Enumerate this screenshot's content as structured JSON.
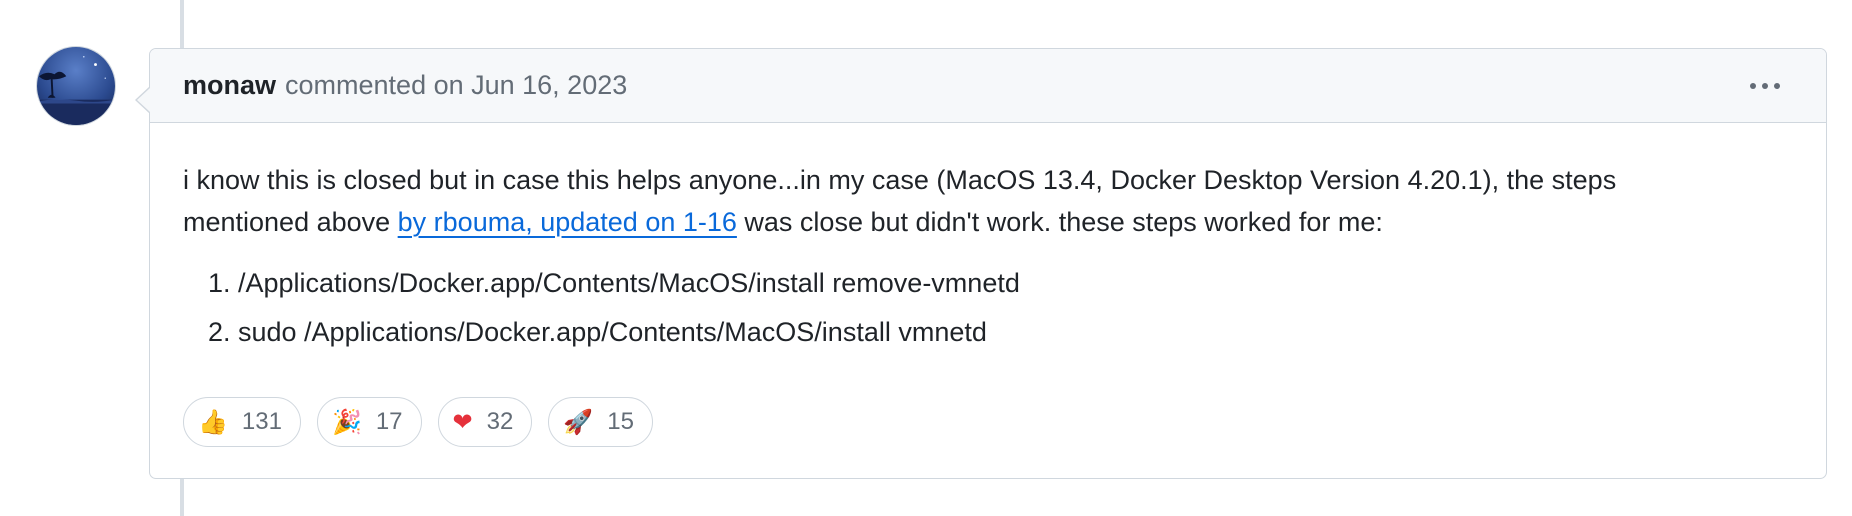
{
  "comment": {
    "author": "monaw",
    "meta": "commented on Jun 16, 2023",
    "body": {
      "para_before_link": "i know this is closed but in case this helps anyone...in my case (MacOS 13.4, Docker Desktop Version 4.20.1), the steps mentioned above ",
      "link_text": "by rbouma, updated on 1-16",
      "para_after_link": " was close but didn't work. these steps worked for me:",
      "steps": [
        "/Applications/Docker.app/Contents/MacOS/install remove-vmnetd",
        "sudo /Applications/Docker.app/Contents/MacOS/install vmnetd"
      ]
    },
    "reactions": [
      {
        "emoji": "👍",
        "icon": "thumbs-up-icon",
        "count": "131"
      },
      {
        "emoji": "🎉",
        "icon": "tada-icon",
        "count": "17"
      },
      {
        "emoji": "❤",
        "icon": "heart-icon",
        "count": "32"
      },
      {
        "emoji": "🚀",
        "icon": "rocket-icon",
        "count": "15"
      }
    ]
  },
  "colors": {
    "link": "#0969da",
    "header_bg": "#f6f8fa",
    "border": "#d0d7de",
    "muted_text": "#636c76",
    "heart": "#e5313b"
  }
}
